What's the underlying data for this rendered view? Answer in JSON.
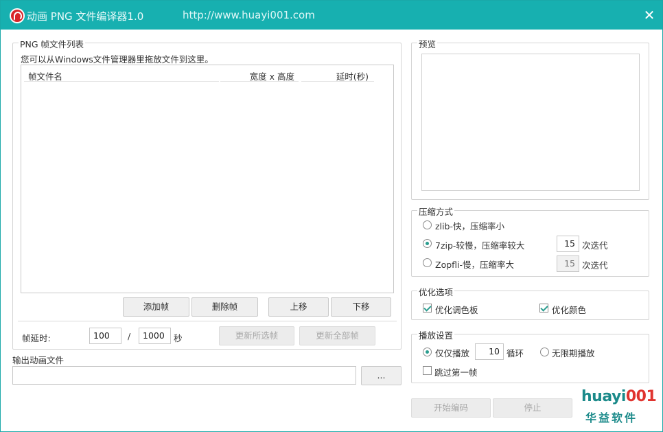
{
  "window": {
    "title": "动画 PNG 文件编译器1.0",
    "url": "http://www.huayi001.com",
    "close_glyph": "✕"
  },
  "frames": {
    "group_title": "PNG 帧文件列表",
    "hint": "您可以从Windows文件管理器里拖放文件到这里。",
    "columns": [
      "帧文件名",
      "宽度 x 高度",
      "延时(秒)"
    ],
    "buttons": {
      "add": "添加帧",
      "delete": "删除帧",
      "move_up": "上移",
      "move_down": "下移"
    },
    "delay_label": "帧延时:",
    "delay_numerator": "100",
    "delay_slash": "/",
    "delay_denominator": "1000",
    "delay_unit": "秒",
    "update_selected": "更新所选帧",
    "update_all": "更新全部帧"
  },
  "output": {
    "label": "输出动画文件",
    "value": "",
    "browse": "..."
  },
  "preview": {
    "group_title": "预览"
  },
  "compression": {
    "group_title": "压缩方式",
    "options": [
      {
        "label": "zlib-快，压缩率小",
        "checked": false
      },
      {
        "label": "7zip-较慢，压缩率较大",
        "checked": true
      },
      {
        "label": "Zopfli-慢，压缩率大",
        "checked": false
      }
    ],
    "iterations_7zip": "15",
    "iterations_zopfli": "15",
    "iterations_label": "次迭代"
  },
  "optimize": {
    "group_title": "优化选项",
    "palette": "优化调色板",
    "colors": "优化颜色"
  },
  "playback": {
    "group_title": "播放设置",
    "play_only": "仅仅播放",
    "loop_count": "10",
    "loop_label": "循环",
    "infinite": "无限期播放",
    "skip_first": "跳过第一帧"
  },
  "actions": {
    "start": "开始编码",
    "stop": "停止"
  },
  "brand": {
    "logo_prefix": "huayi",
    "logo_suffix": "001",
    "logo_cn": "华益软件"
  }
}
